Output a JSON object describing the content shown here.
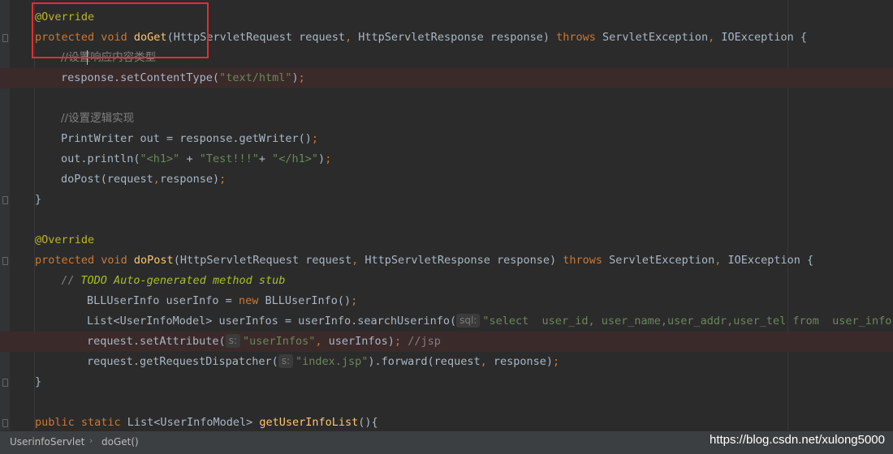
{
  "editor": {
    "lines": {
      "l1": {
        "ann": "@Override"
      },
      "l2": {
        "kw1": "protected void ",
        "fn": "doGet",
        "p1": "(HttpServletRequest request",
        "c1": ", ",
        "p2": "HttpServletResponse response) ",
        "kw2": "throws ",
        "p3": "ServletException",
        "c2": ", ",
        "p4": "IOException {"
      },
      "l3": {
        "cmt": "//设置响应内容类型"
      },
      "l4": {
        "a": "response.setContentType(",
        "str": "\"text/html\"",
        "b": ")",
        "semi": ";"
      },
      "l6": {
        "cmt": "//设置逻辑实现"
      },
      "l7": {
        "a": "PrintWriter out = response.getWriter()",
        "semi": ";"
      },
      "l8": {
        "a": "out.println(",
        "s1": "\"<h1>\"",
        "b": " + ",
        "s2": "\"Test!!!\"",
        "c": "+ ",
        "s3": "\"</h1>\"",
        "d": ")",
        "semi": ";"
      },
      "l9": {
        "a": "doPost(request",
        "c": ",",
        "b": "response)",
        "semi": ";"
      },
      "l10": {
        "a": "}"
      },
      "l12": {
        "ann": "@Override"
      },
      "l13": {
        "kw1": "protected void ",
        "fn": "doPost",
        "p1": "(HttpServletRequest request",
        "c1": ", ",
        "p2": "HttpServletResponse response) ",
        "kw2": "throws ",
        "p3": "ServletException",
        "c2": ", ",
        "p4": "IOException {"
      },
      "l14": {
        "cmt": "// ",
        "todo": "TODO Auto-generated method stub"
      },
      "l15": {
        "a": "BLLUserInfo userInfo = ",
        "kw": "new ",
        "b": "BLLUserInfo()",
        "semi": ";"
      },
      "l16": {
        "a": "List<UserInfoModel> userInfos = userInfo.searchUserinfo(",
        "hint": "sql:",
        "str": "\"select  user_id, user_name,user_addr,user_tel from  user_info\")"
      },
      "l17": {
        "a": "request.setAttribute(",
        "hint": "s:",
        "str": "\"userInfos\"",
        "c": ", ",
        "b": "userInfos)",
        "semi": "; ",
        "cmt": "//jsp"
      },
      "l18": {
        "a": "request.getRequestDispatcher(",
        "hint": "s:",
        "str": "\"index.jsp\"",
        "b": ").forward(request",
        "c": ", ",
        "d": "response)",
        "semi": ";"
      },
      "l19": {
        "a": "}"
      },
      "l21": {
        "kw1": "public static ",
        "a": "List<UserInfoModel> ",
        "fn": "getUserInfoList",
        "b": "(){"
      }
    }
  },
  "statusbar": {
    "crumb_class": "UserinfoServlet",
    "crumb_method": "doGet()",
    "watermark": "https://blog.csdn.net/xulong5000"
  }
}
